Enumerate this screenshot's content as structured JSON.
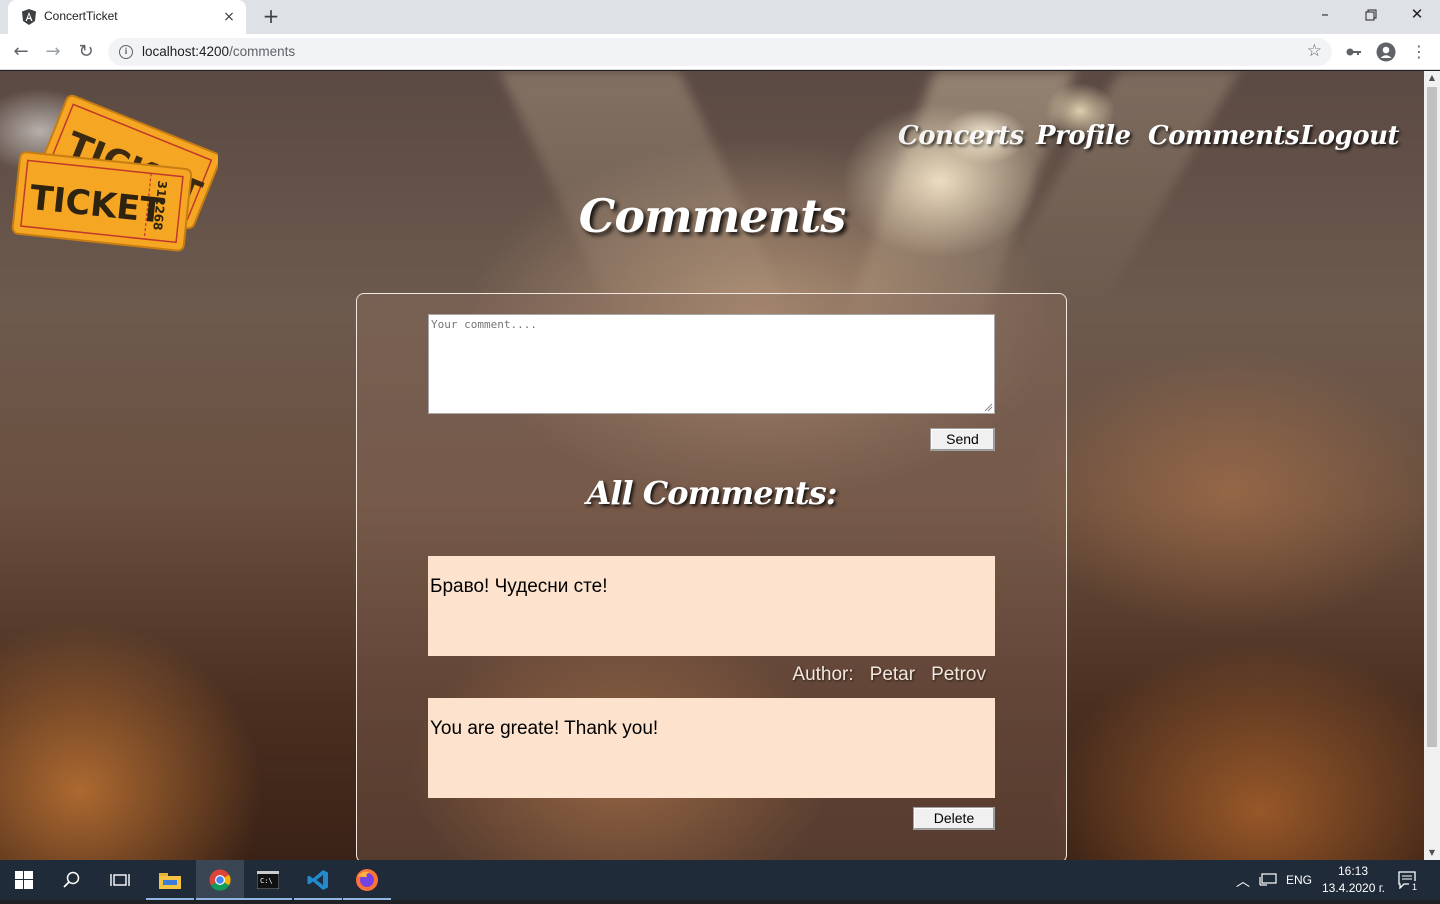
{
  "browser": {
    "tab_title": "ConcertTicket",
    "url_host": "localhost:4200",
    "url_path": "/comments",
    "tab_close": "×",
    "new_tab": "+"
  },
  "site": {
    "nav": [
      {
        "label": "Concerts"
      },
      {
        "label": "Profile"
      },
      {
        "label": "Comments"
      },
      {
        "label": "Logout"
      }
    ],
    "logo": {
      "back_text": "TICKET",
      "front_text": "TICKET",
      "serial": "312268"
    },
    "page_title": "Comments"
  },
  "comment_form": {
    "placeholder": "Your comment....",
    "send_label": "Send"
  },
  "comments_section": {
    "title": "All Comments:",
    "comments": [
      {
        "text": "Браво! Чудесни сте!",
        "author_label": "Author:",
        "first_name": "Petar",
        "last_name": "Petrov"
      },
      {
        "text": "You are greate! Thank you!",
        "delete_label": "Delete"
      }
    ]
  },
  "taskbar": {
    "language": "ENG",
    "time": "16:13",
    "date": "13.4.2020 г.",
    "notification_count": "1"
  },
  "colors": {
    "comment_card": "#fde3ce",
    "taskbar": "#1f2b38"
  }
}
